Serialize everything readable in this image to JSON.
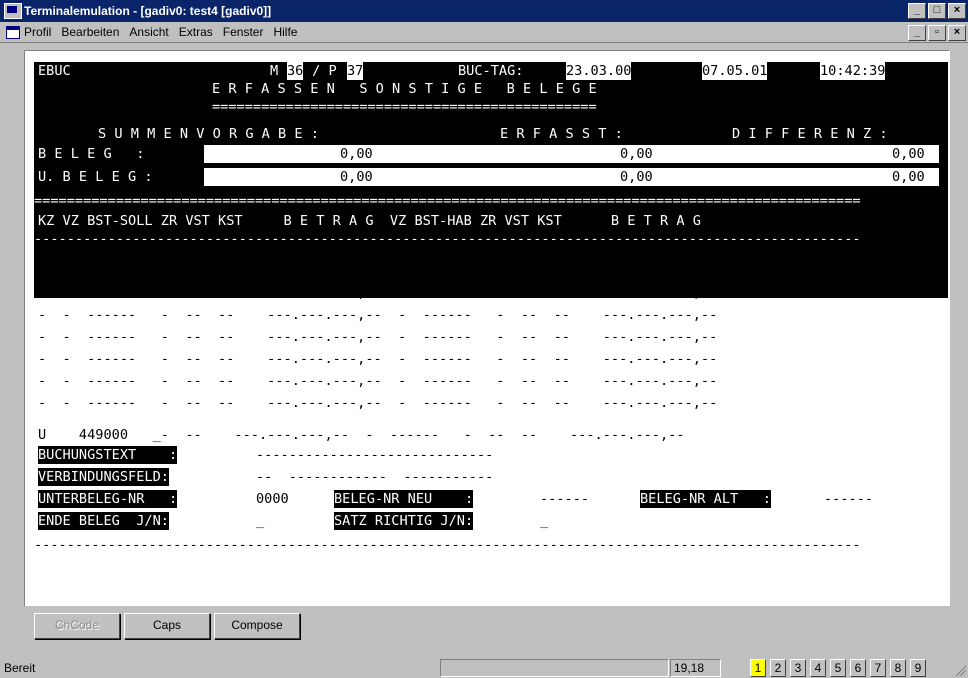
{
  "window": {
    "title": "Terminalemulation - [gadiv0: test4 [gadiv0]]"
  },
  "menu": [
    "Profil",
    "Bearbeiten",
    "Ansicht",
    "Extras",
    "Fenster",
    "Hilfe"
  ],
  "terminal": {
    "program": "EBUC",
    "m_label": "M",
    "m_value": "36",
    "p_sep": " / P ",
    "p_value": "37",
    "buc_tag_label": "BUC-TAG:",
    "buc_tag_value": "23.03.00",
    "date": "07.05.01",
    "time": "10:42:39",
    "title": "E R F A S S E N   S O N S T I G E   B E L E G E",
    "title_underline": "===============================================",
    "summen_header": "S U M M E N V O R G A B E :",
    "erfasst_header": "E R F A S S T :",
    "differenz_header": "D I F F E R E N Z :",
    "beleg_label": "B E L E G   :",
    "beleg_summen": "0,00",
    "beleg_erfasst": "0,00",
    "beleg_differenz": "0,00",
    "ubeleg_label": "U. B E L E G :",
    "ubeleg_summen": "0,00",
    "ubeleg_erfasst": "0,00",
    "ubeleg_differenz": "0,00",
    "separator_eq": "=====================================================================================================",
    "column_header": "KZ VZ BST-SOLL ZR VST KST     B E T R A G  VZ BST-HAB ZR VST KST      B E T R A G",
    "separator_dash": "-----------------------------------------------------------------------------------------------------",
    "empty_row": "-  -  ------   -  --  --    ---.---.---,--  -  ------   -  --  --    ---.---.---,--",
    "u_row": "U    449000   _-  --    ---.---.---,--  -  ------   -  --  --    ---.---.---,--",
    "buchungstext_label": "BUCHUNGSTEXT    :",
    "buchungstext_value": "-----------------------------",
    "verbindungsfeld_label": "VERBINDUNGSFELD:",
    "verbindungsfeld_value": "--  ------------  -----------",
    "unterbeleg_label": "UNTERBELEG-NR   :",
    "unterbeleg_value": "0000",
    "beleg_nr_neu_label": "BELEG-NR NEU    :",
    "beleg_nr_neu_value": "------",
    "beleg_nr_alt_label": "BELEG-NR ALT   :",
    "beleg_nr_alt_value": "------",
    "ende_beleg_label": "ENDE BELEG  J/N:",
    "ende_beleg_value": "_",
    "satz_richtig_label": "SATZ RICHTIG J/N:",
    "satz_richtig_value": "_",
    "bottom_dash": "-----------------------------------------------------------------------------------------------------"
  },
  "buttons": {
    "chcode": "ChCode",
    "caps": "Caps",
    "compose": "Compose"
  },
  "status": {
    "text": "Bereit",
    "cursor": "19,18",
    "sessions": [
      "1",
      "2",
      "3",
      "4",
      "5",
      "6",
      "7",
      "8",
      "9"
    ],
    "active_session": "1"
  }
}
